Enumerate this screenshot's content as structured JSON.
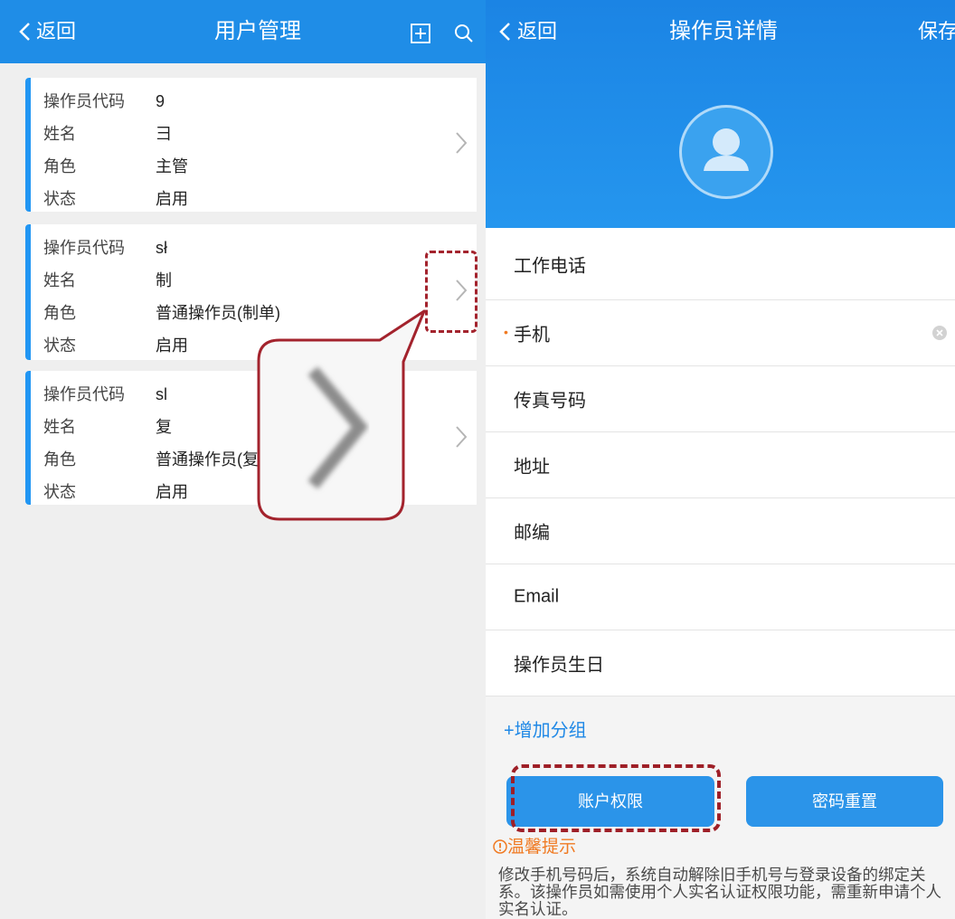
{
  "left": {
    "header": {
      "back": "返回",
      "title": "用户管理"
    },
    "cards": [
      {
        "rows": [
          {
            "label": "操作员代码",
            "value": "9"
          },
          {
            "label": "姓名",
            "value": "彐"
          },
          {
            "label": "角色",
            "value": "主管"
          },
          {
            "label": "状态",
            "value": "启用"
          }
        ]
      },
      {
        "rows": [
          {
            "label": "操作员代码",
            "value": "sł"
          },
          {
            "label": "姓名",
            "value": "制"
          },
          {
            "label": "角色",
            "value": "普通操作员(制单)"
          },
          {
            "label": "状态",
            "value": "启用"
          }
        ]
      },
      {
        "rows": [
          {
            "label": "操作员代码",
            "value": "sl"
          },
          {
            "label": "姓名",
            "value": "复"
          },
          {
            "label": "角色",
            "value": "普通操作员(复"
          },
          {
            "label": "状态",
            "value": "启用"
          }
        ]
      }
    ],
    "icons": [
      "back-chevron-icon",
      "add-box-icon",
      "search-icon",
      "chevron-right-icon"
    ]
  },
  "right": {
    "header": {
      "back": "返回",
      "title": "操作员详情",
      "save": "保存"
    },
    "fields": [
      {
        "label": "工作电话"
      },
      {
        "label": "手机",
        "marker": "•"
      },
      {
        "label": "传真号码"
      },
      {
        "label": "地址"
      },
      {
        "label": "邮编"
      },
      {
        "label": "Email"
      },
      {
        "label": "操作员生日"
      }
    ],
    "add_group": "+增加分组",
    "buttons": {
      "permissions": "账户权限",
      "reset_password": "密码重置"
    },
    "tip": {
      "title": "温馨提示",
      "text": "修改手机号码后，系统自动解除旧手机号与登录设备的绑定关系。该操作员如需使用个人实名认证权限功能，需重新申请个人实名认证。"
    },
    "icons": [
      "back-chevron-icon",
      "avatar-user-icon",
      "clear-input-icon",
      "warning-circle-icon"
    ]
  },
  "colors": {
    "primary": "#2196f3",
    "annotation": "#a3232d",
    "warning": "#f07a22",
    "background": "#efefef"
  }
}
